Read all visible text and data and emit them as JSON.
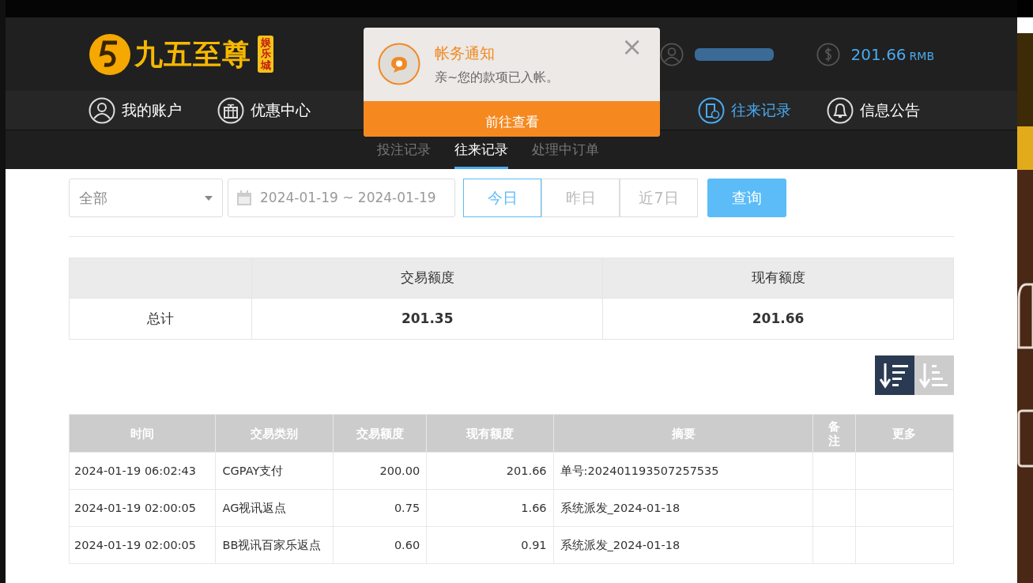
{
  "brand": {
    "name": "九五至尊",
    "badge": "娱乐城"
  },
  "account": {
    "balance": "201.66",
    "currency": "RMB"
  },
  "nav": [
    {
      "label": "我的账户",
      "kind": "user",
      "selected": false
    },
    {
      "label": "优惠中心",
      "kind": "gift",
      "selected": false
    },
    {
      "label": "往来记录",
      "kind": "record",
      "selected": true
    },
    {
      "label": "信息公告",
      "kind": "bell",
      "selected": false
    }
  ],
  "subtabs": [
    {
      "label": "投注记录",
      "selected": false
    },
    {
      "label": "往来记录",
      "selected": true
    },
    {
      "label": "处理中订单",
      "selected": false
    }
  ],
  "filters": {
    "type": "全部",
    "date_range": "2024-01-19 ~ 2024-01-19",
    "quick": [
      {
        "label": "今日",
        "selected": true
      },
      {
        "label": "昨日",
        "selected": false
      },
      {
        "label": "近7日",
        "selected": false
      }
    ],
    "search_button": "查询"
  },
  "summary": {
    "columns": [
      "交易额度",
      "现有额度"
    ],
    "row": {
      "label": "总计",
      "values": [
        "201.35",
        "201.66"
      ]
    }
  },
  "sort": [
    {
      "selected": true
    },
    {
      "selected": false
    }
  ],
  "table": {
    "columns": [
      "时间",
      "交易类别",
      "交易额度",
      "现有额度",
      "摘要",
      "备注",
      "更多"
    ],
    "rows": [
      [
        "2024-01-19 06:02:43",
        "CGPAY支付",
        "200.00",
        "201.66",
        "单号:202401193507257535",
        "",
        ""
      ],
      [
        "2024-01-19 02:00:05",
        "AG视讯返点",
        "0.75",
        "1.66",
        "系统派发_2024-01-18",
        "",
        ""
      ],
      [
        "2024-01-19 02:00:05",
        "BB视讯百家乐返点",
        "0.60",
        "0.91",
        "系统派发_2024-01-18",
        "",
        ""
      ]
    ]
  },
  "notification": {
    "title": "帐务通知",
    "message": "亲~您的款项已入帐。",
    "action": "前往查看",
    "close": "×"
  }
}
